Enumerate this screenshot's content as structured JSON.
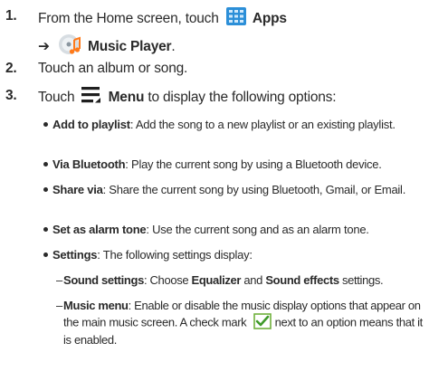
{
  "steps": [
    {
      "number": "1.",
      "line1_prefix": "From the Home screen, touch",
      "apps_label": "Apps",
      "arrow": "➔",
      "music_player_label": "Music Player",
      "period": ".",
      "icons": [
        "apps-grid-icon",
        "music-player-icon"
      ]
    },
    {
      "number": "2.",
      "text": "Touch an album or song."
    },
    {
      "number": "3.",
      "prefix": "Touch",
      "menu_label": "Menu",
      "suffix": "to display the following options:",
      "icons": [
        "menu-icon"
      ]
    }
  ],
  "options": [
    {
      "term": "Add to playlist",
      "desc": ": Add the song to a new playlist or an existing playlist."
    },
    {
      "term": "Via Bluetooth",
      "desc": ": Play the current song by using a Bluetooth device."
    },
    {
      "term": "Share via",
      "desc": ": Share the current song by using Bluetooth, Gmail, or Email."
    },
    {
      "term": "Set as alarm tone",
      "desc": ": Use the current song and as an alarm tone."
    },
    {
      "term": "Settings",
      "desc": ": The following settings display:"
    }
  ],
  "settings": {
    "sound": {
      "dash": "–",
      "term": "Sound settings",
      "t1": ": Choose ",
      "eq": "Equalizer",
      "and": " and ",
      "fx": "Sound effects",
      "t2": " settings."
    },
    "music_menu": {
      "dash": "–",
      "term": "Music menu",
      "desc_before": ": Enable or disable the music display options that appear on the main music screen. A check mark",
      "desc_after": "next to an option means that it is enabled.",
      "icon": "checkmark-icon"
    }
  },
  "colors": {
    "text": "#2a2a2a",
    "apps_icon": "#2c8fd8",
    "check_border": "#6fb13c",
    "check_mark": "#3f9a2a"
  }
}
